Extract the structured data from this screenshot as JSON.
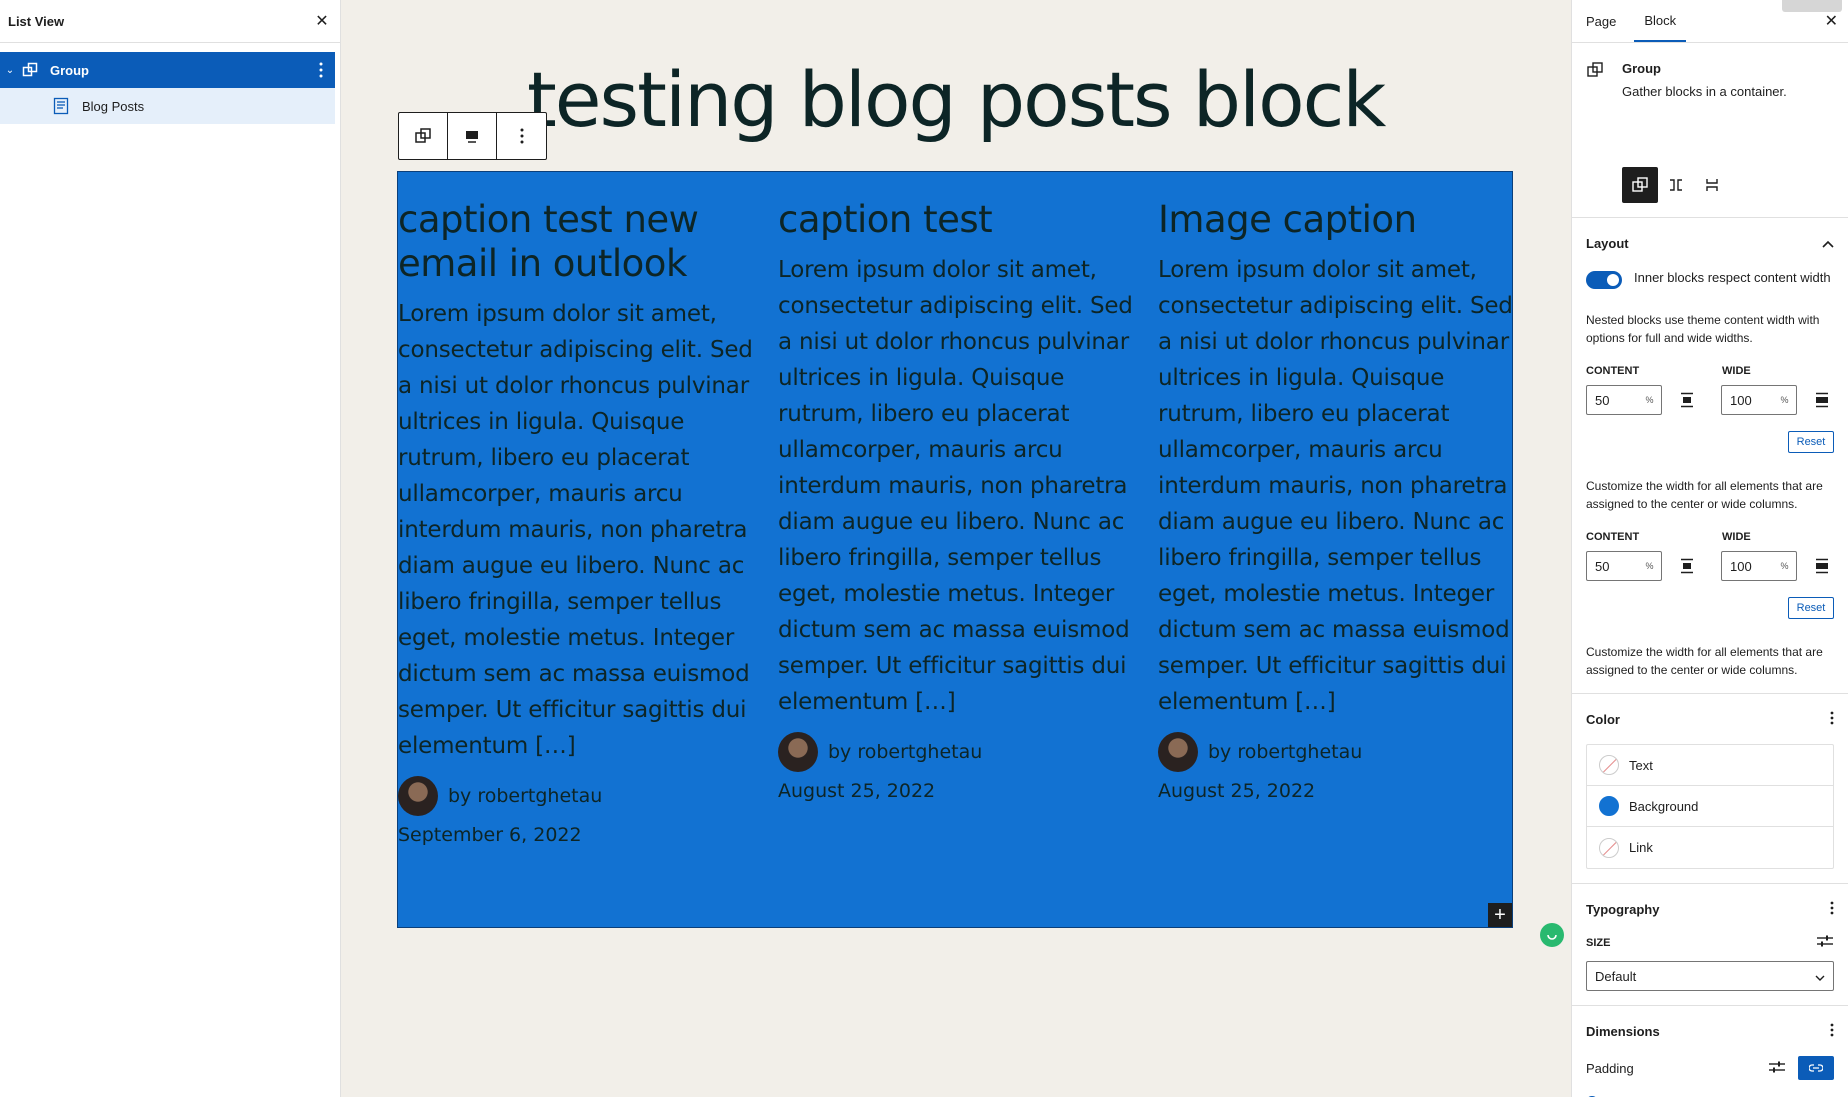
{
  "list_view": {
    "title": "List View",
    "items": [
      {
        "label": "Group"
      },
      {
        "label": "Blog Posts"
      }
    ]
  },
  "canvas": {
    "page_title": "testing blog posts block",
    "posts": [
      {
        "title": "caption test new email in outlook",
        "excerpt": "Lorem ipsum dolor sit amet, consectetur adipiscing elit. Sed a nisi ut dolor rhoncus pulvinar ultrices in ligula. Quisque rutrum, libero eu placerat ullamcorper, mauris arcu interdum mauris, non pharetra diam augue eu libero. Nunc ac libero fringilla, semper tellus eget, molestie metus. Integer dictum sem ac massa euismod semper. Ut efficitur sagittis dui elementum […]",
        "author": "by robertghetau",
        "date": "September 6, 2022"
      },
      {
        "title": "caption test",
        "excerpt": "Lorem ipsum dolor sit amet, consectetur adipiscing elit. Sed a nisi ut dolor rhoncus pulvinar ultrices in ligula. Quisque rutrum, libero eu placerat ullamcorper, mauris arcu interdum mauris, non pharetra diam augue eu libero. Nunc ac libero fringilla, semper tellus eget, molestie metus. Integer dictum sem ac massa euismod semper. Ut efficitur sagittis dui elementum […]",
        "author": "by robertghetau",
        "date": "August 25, 2022"
      },
      {
        "title": "Image caption",
        "excerpt": "Lorem ipsum dolor sit amet, consectetur adipiscing elit. Sed a nisi ut dolor rhoncus pulvinar ultrices in ligula. Quisque rutrum, libero eu placerat ullamcorper, mauris arcu interdum mauris, non pharetra diam augue eu libero. Nunc ac libero fringilla, semper tellus eget, molestie metus. Integer dictum sem ac massa euismod semper. Ut efficitur sagittis dui elementum […]",
        "author": "by robertghetau",
        "date": "August 25, 2022"
      }
    ],
    "background_color": "#1272d2"
  },
  "sidebar": {
    "tabs": [
      "Page",
      "Block"
    ],
    "active_tab": "Block",
    "block": {
      "name": "Group",
      "description": "Gather blocks in a container."
    },
    "layout": {
      "title": "Layout",
      "toggle_label": "Inner blocks respect content width",
      "toggle_on": true,
      "help_1": "Nested blocks use theme content width with options for full and wide widths.",
      "content_label": "CONTENT",
      "wide_label": "WIDE",
      "content_value_1": "50",
      "wide_value_1": "100",
      "unit": "%",
      "reset_label": "Reset",
      "help_2": "Customize the width for all elements that are assigned to the center or wide columns.",
      "content_value_2": "50",
      "wide_value_2": "100"
    },
    "color": {
      "title": "Color",
      "items": [
        "Text",
        "Background",
        "Link"
      ],
      "background_swatch": "#1272d2"
    },
    "typography": {
      "title": "Typography",
      "size_label": "SIZE",
      "size_value": "Default"
    },
    "dimensions": {
      "title": "Dimensions",
      "padding_label": "Padding"
    }
  }
}
